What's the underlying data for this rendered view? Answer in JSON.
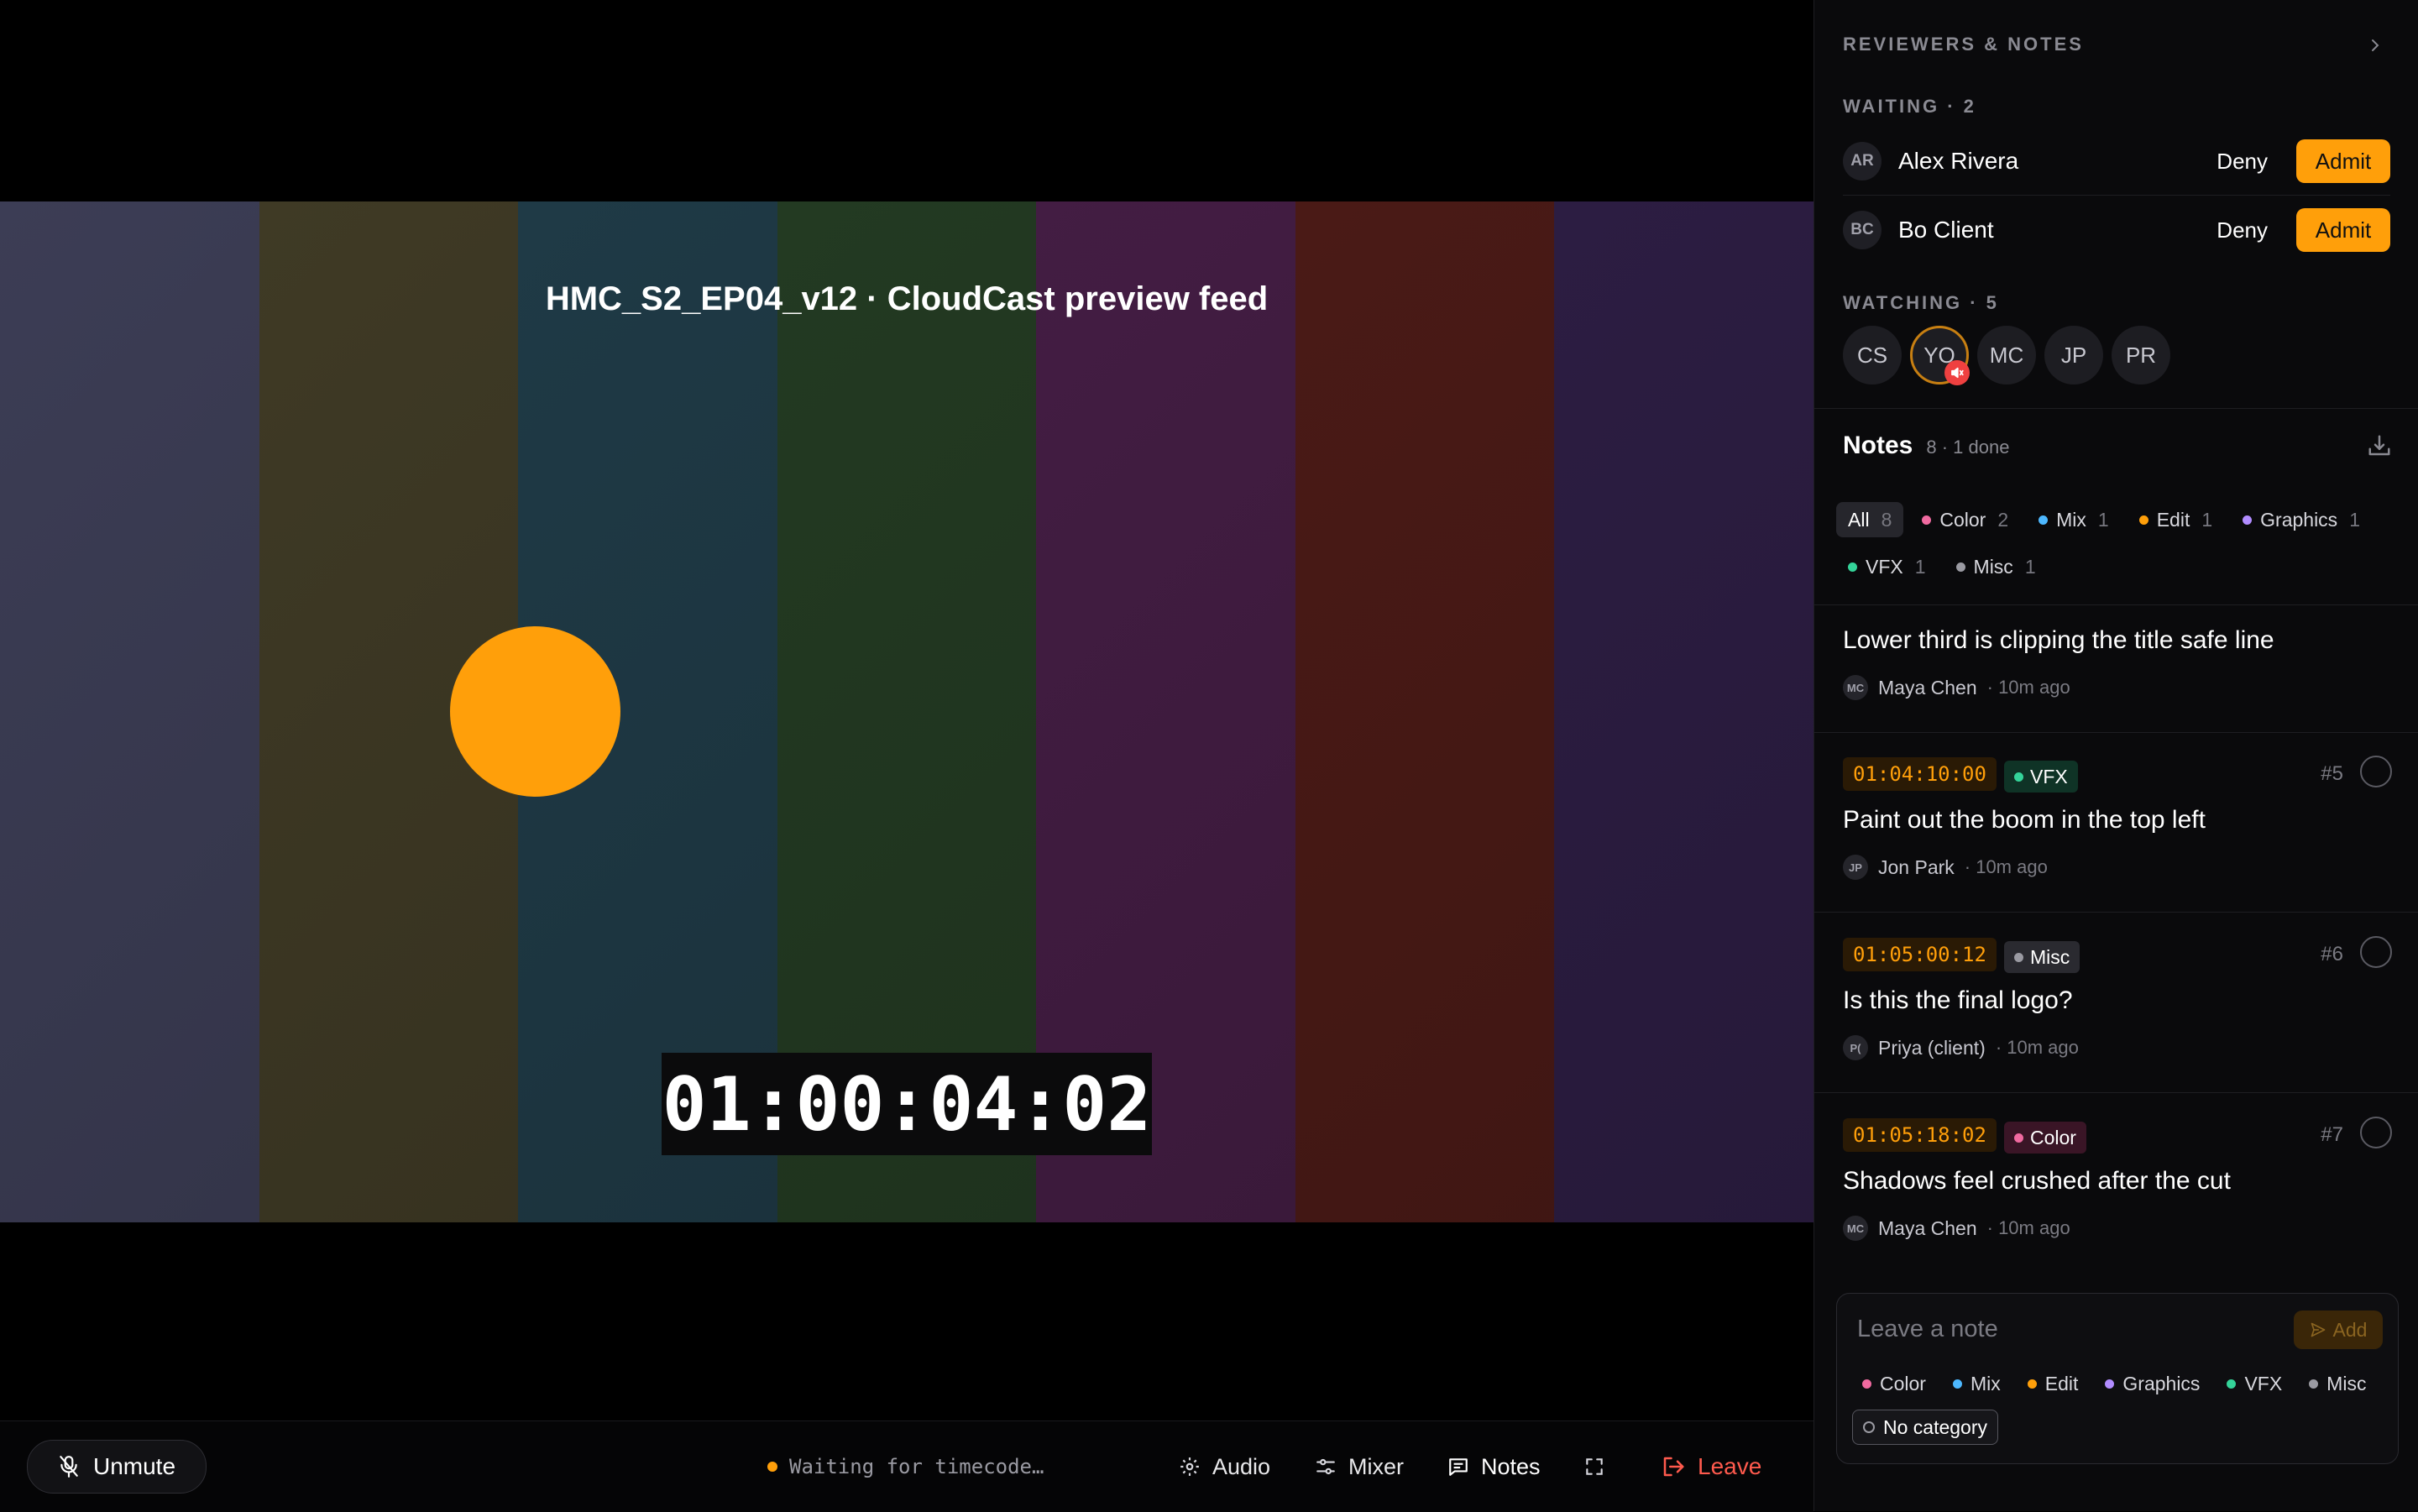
{
  "video": {
    "feed_title": "HMC_S2_EP04_v12 · CloudCast preview feed",
    "timecode": "01:00:04:02",
    "bar_colors": [
      "#3c3d55",
      "#3f3a25",
      "#1f3a46",
      "#233a22",
      "#431d43",
      "#4a1a16",
      "#2c1d42"
    ]
  },
  "bottombar": {
    "unmute_label": "Unmute",
    "timecode_status": "Waiting for timecode…",
    "audio_label": "Audio",
    "mixer_label": "Mixer",
    "notes_label": "Notes",
    "leave_label": "Leave"
  },
  "sidebar": {
    "title": "REVIEWERS & NOTES",
    "waiting_label": "WAITING · 2",
    "waiting": [
      {
        "initials": "AR",
        "name": "Alex Rivera",
        "deny": "Deny",
        "admit": "Admit"
      },
      {
        "initials": "BC",
        "name": "Bo Client",
        "deny": "Deny",
        "admit": "Admit"
      }
    ],
    "watching_label": "WATCHING · 5",
    "watching": [
      "CS",
      "YO",
      "MC",
      "JP",
      "PR"
    ],
    "notes_title": "Notes",
    "notes_meta": "8 · 1 done",
    "filters": [
      {
        "label": "All",
        "count": "8",
        "color": ""
      },
      {
        "label": "Color",
        "count": "2",
        "color": "#f06aa0"
      },
      {
        "label": "Mix",
        "count": "1",
        "color": "#4db8ff"
      },
      {
        "label": "Edit",
        "count": "1",
        "color": "#ff9f0a"
      },
      {
        "label": "Graphics",
        "count": "1",
        "color": "#b18cff"
      },
      {
        "label": "VFX",
        "count": "1",
        "color": "#34d399"
      },
      {
        "label": "Misc",
        "count": "1",
        "color": "#9a9aa2"
      }
    ],
    "notes": [
      {
        "timecode": "",
        "category": "",
        "num": "",
        "text": "Lower third is clipping the title safe line",
        "author_initials": "MC",
        "author": "Maya Chen",
        "ago": "· 10m ago"
      },
      {
        "timecode": "01:04:10:00",
        "category": "VFX",
        "num": "#5",
        "text": "Paint out the boom in the top left",
        "author_initials": "JP",
        "author": "Jon Park",
        "ago": "· 10m ago"
      },
      {
        "timecode": "01:05:00:12",
        "category": "Misc",
        "num": "#6",
        "text": "Is this the final logo?",
        "author_initials": "P(",
        "author": "Priya (client)",
        "ago": "· 10m ago"
      },
      {
        "timecode": "01:05:18:02",
        "category": "Color",
        "num": "#7",
        "text": "Shadows feel crushed after the cut",
        "author_initials": "MC",
        "author": "Maya Chen",
        "ago": "· 10m ago"
      }
    ],
    "composer": {
      "placeholder": "Leave a note",
      "add_label": "Add",
      "categories": [
        "Color",
        "Mix",
        "Edit",
        "Graphics",
        "VFX",
        "Misc"
      ],
      "no_category": "No category"
    }
  },
  "colors": {
    "accent": "#ff9f0a",
    "danger": "#ff5a4d",
    "Color": "#f06aa0",
    "Mix": "#4db8ff",
    "Edit": "#ff9f0a",
    "Graphics": "#b18cff",
    "VFX": "#34d399",
    "Misc": "#9a9aa2"
  }
}
